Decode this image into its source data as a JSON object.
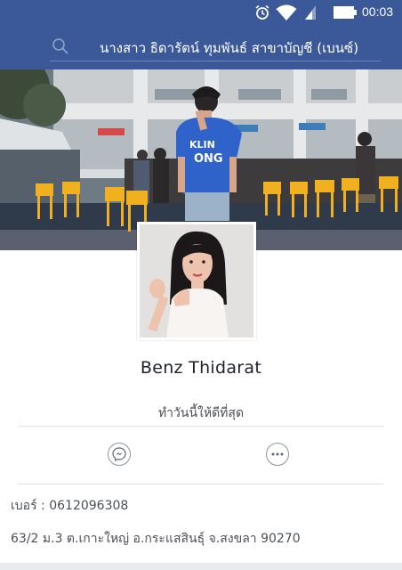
{
  "status_bar": {
    "time": "00:03",
    "icons": [
      "alarm-icon",
      "wifi-icon",
      "signal-icon",
      "battery-icon"
    ]
  },
  "header": {
    "search_icon": "search-icon",
    "title": "นางสาว ธิดารัตน์ ทุมพันธ์  สาขาบัญชี  (เบนซ์)"
  },
  "cover": {
    "shirt_text_line1": "KLIN",
    "shirt_text_line2": "ONG"
  },
  "profile": {
    "name": "Benz Thidarat",
    "bio": "ทำวันนี้ให้ดีที่สุด"
  },
  "actions": {
    "message_icon": "messenger-icon",
    "more_icon": "more-icon"
  },
  "details": {
    "phone": "เบอร์ : 0612096308",
    "address": "63/2 ม.3 ต.เกาะใหญ่ อ.กระแสสินธุ์ จ.สงขลา 90270"
  },
  "colors": {
    "brand": "#3b5998",
    "text": "#1d2129",
    "secondary_text": "#4b4f56",
    "divider": "#dddfe2"
  }
}
